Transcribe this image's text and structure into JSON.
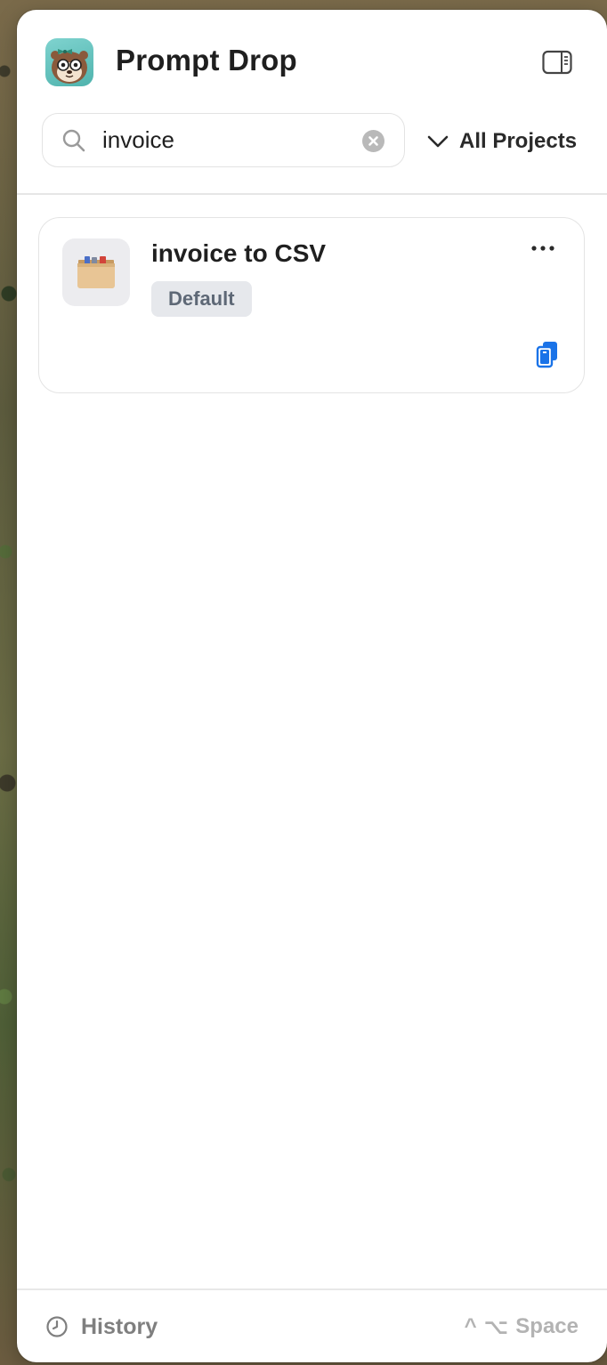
{
  "header": {
    "app_title": "Prompt Drop",
    "app_icon": "otter-mascot-icon",
    "sidebar_toggle_icon": "sidebar-right-icon"
  },
  "search": {
    "value": "invoice",
    "placeholder": "Search",
    "clear_icon": "clear-circle-icon"
  },
  "filter": {
    "projects_label": "All Projects",
    "chevron_icon": "chevron-down-icon"
  },
  "prompts": [
    {
      "title": "invoice to CSV",
      "badge": "Default",
      "thumb_icon": "card-file-box-icon",
      "more_icon": "ellipsis-icon",
      "copy_icon": "copy-icon"
    }
  ],
  "footer": {
    "history_label": "History",
    "history_icon": "clock-icon",
    "shortcut_ctrl": "^",
    "shortcut_option": "⌥",
    "shortcut_key": "Space"
  },
  "colors": {
    "accent": "#1a73e8",
    "badge_bg": "#e6e8ec",
    "badge_text": "#5e6876"
  }
}
